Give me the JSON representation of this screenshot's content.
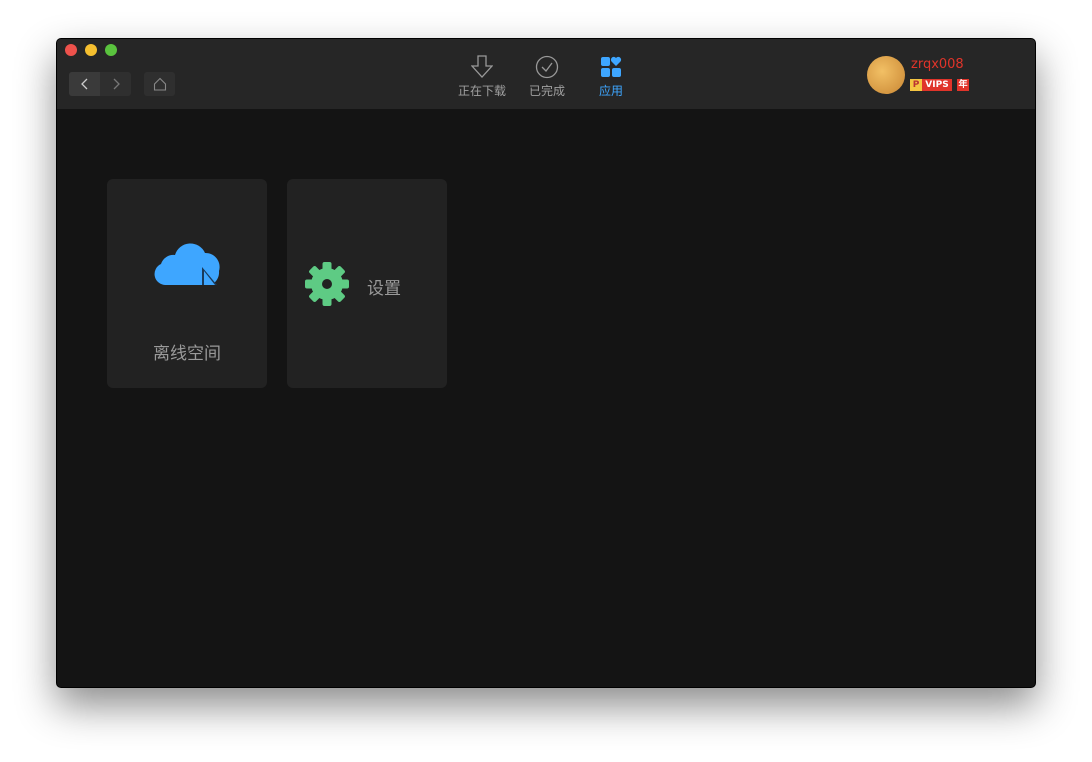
{
  "toolbar": {
    "tabs": [
      {
        "label": "正在下载",
        "icon": "download-icon"
      },
      {
        "label": "已完成",
        "icon": "check-circle-icon"
      },
      {
        "label": "应用",
        "icon": "apps-icon",
        "active": true
      }
    ]
  },
  "user": {
    "name": "zrqx008",
    "badges": [
      "P",
      "VIPS",
      "年"
    ]
  },
  "apps": [
    {
      "label": "离线空间",
      "icon": "cloud-icon"
    },
    {
      "label": "设置",
      "icon": "gear-icon"
    }
  ],
  "colors": {
    "accent": "#3ea6ff",
    "gear": "#5ecb84",
    "username": "#e0342a"
  }
}
